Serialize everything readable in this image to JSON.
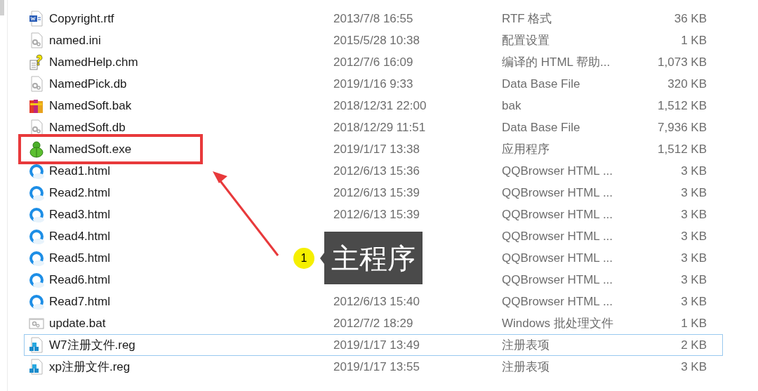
{
  "files": [
    {
      "kind": "document",
      "name": "Copyright.rtf",
      "date": "2013/7/8 16:55",
      "type": "RTF 格式",
      "size": "36 KB",
      "focused": false,
      "marked": false
    },
    {
      "kind": "settings",
      "name": "named.ini",
      "date": "2015/5/28 10:38",
      "type": "配置设置",
      "size": "1 KB",
      "focused": false,
      "marked": false
    },
    {
      "kind": "help",
      "name": "NamedHelp.chm",
      "date": "2012/7/6 16:09",
      "type": "编译的 HTML 帮助...",
      "size": "1,073 KB",
      "focused": false,
      "marked": false
    },
    {
      "kind": "generic",
      "name": "NamedPick.db",
      "date": "2019/1/16 9:33",
      "type": "Data Base File",
      "size": "320 KB",
      "focused": false,
      "marked": false
    },
    {
      "kind": "archive",
      "name": "NamedSoft.bak",
      "date": "2018/12/31 22:00",
      "type": "bak",
      "size": "1,512 KB",
      "focused": false,
      "marked": false
    },
    {
      "kind": "generic",
      "name": "NamedSoft.db",
      "date": "2018/12/29 11:51",
      "type": "Data Base File",
      "size": "7,936 KB",
      "focused": false,
      "marked": false
    },
    {
      "kind": "program",
      "name": "NamedSoft.exe",
      "date": "2019/1/17 13:38",
      "type": "应用程序",
      "size": "1,512 KB",
      "focused": false,
      "marked": true
    },
    {
      "kind": "web",
      "name": "Read1.html",
      "date": "2012/6/13 15:36",
      "type": "QQBrowser HTML ...",
      "size": "3 KB",
      "focused": false,
      "marked": false
    },
    {
      "kind": "web",
      "name": "Read2.html",
      "date": "2012/6/13 15:39",
      "type": "QQBrowser HTML ...",
      "size": "3 KB",
      "focused": false,
      "marked": false
    },
    {
      "kind": "web",
      "name": "Read3.html",
      "date": "2012/6/13 15:39",
      "type": "QQBrowser HTML ...",
      "size": "3 KB",
      "focused": false,
      "marked": false
    },
    {
      "kind": "web",
      "name": "Read4.html",
      "type": "QQBrowser HTML ...",
      "size": "3 KB",
      "focused": false,
      "marked": false
    },
    {
      "kind": "web",
      "name": "Read5.html",
      "type": "QQBrowser HTML ...",
      "size": "3 KB",
      "focused": false,
      "marked": false
    },
    {
      "kind": "web",
      "name": "Read6.html",
      "type": "QQBrowser HTML ...",
      "size": "3 KB",
      "focused": false,
      "marked": false
    },
    {
      "kind": "web",
      "name": "Read7.html",
      "date": "2012/6/13 15:40",
      "type": "QQBrowser HTML ...",
      "size": "3 KB",
      "focused": false,
      "marked": false
    },
    {
      "kind": "script",
      "name": "update.bat",
      "date": "2012/7/2 18:29",
      "type": "Windows 批处理文件",
      "size": "1 KB",
      "focused": false,
      "marked": false
    },
    {
      "kind": "registry",
      "name": "W7注册文件.reg",
      "date": "2019/1/17 13:49",
      "type": "注册表项",
      "size": "2 KB",
      "focused": true,
      "marked": false
    },
    {
      "kind": "registry",
      "name": "xp注册文件.reg",
      "date": "2019/1/17 13:55",
      "type": "注册表项",
      "size": "3 KB",
      "focused": false,
      "marked": false
    }
  ],
  "callout": {
    "number": "1",
    "text": "主程序"
  }
}
